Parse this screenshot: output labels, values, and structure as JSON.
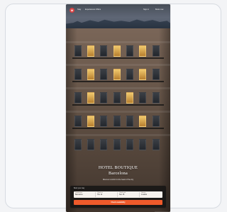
{
  "header": {
    "brand": "M",
    "nav": [
      "Stay",
      "Experiences",
      "Offers"
    ],
    "right_links": [
      "Sign in",
      "Book now"
    ]
  },
  "hero": {
    "title": "Hotel Boutique",
    "city": "Barcelona",
    "subtitle": "Discover comfort in the heart of the city"
  },
  "booking": {
    "label": "Book your stay",
    "fields": [
      {
        "label": "Destination",
        "value": "Barcelona"
      },
      {
        "label": "Check-in",
        "value": "Thu 12"
      },
      {
        "label": "Check-out",
        "value": "Sun 15"
      },
      {
        "label": "Guests",
        "value": "2 adults"
      }
    ],
    "cta": "Check availability"
  },
  "colors": {
    "accent": "#ef5a2b",
    "brand": "#d94242"
  }
}
